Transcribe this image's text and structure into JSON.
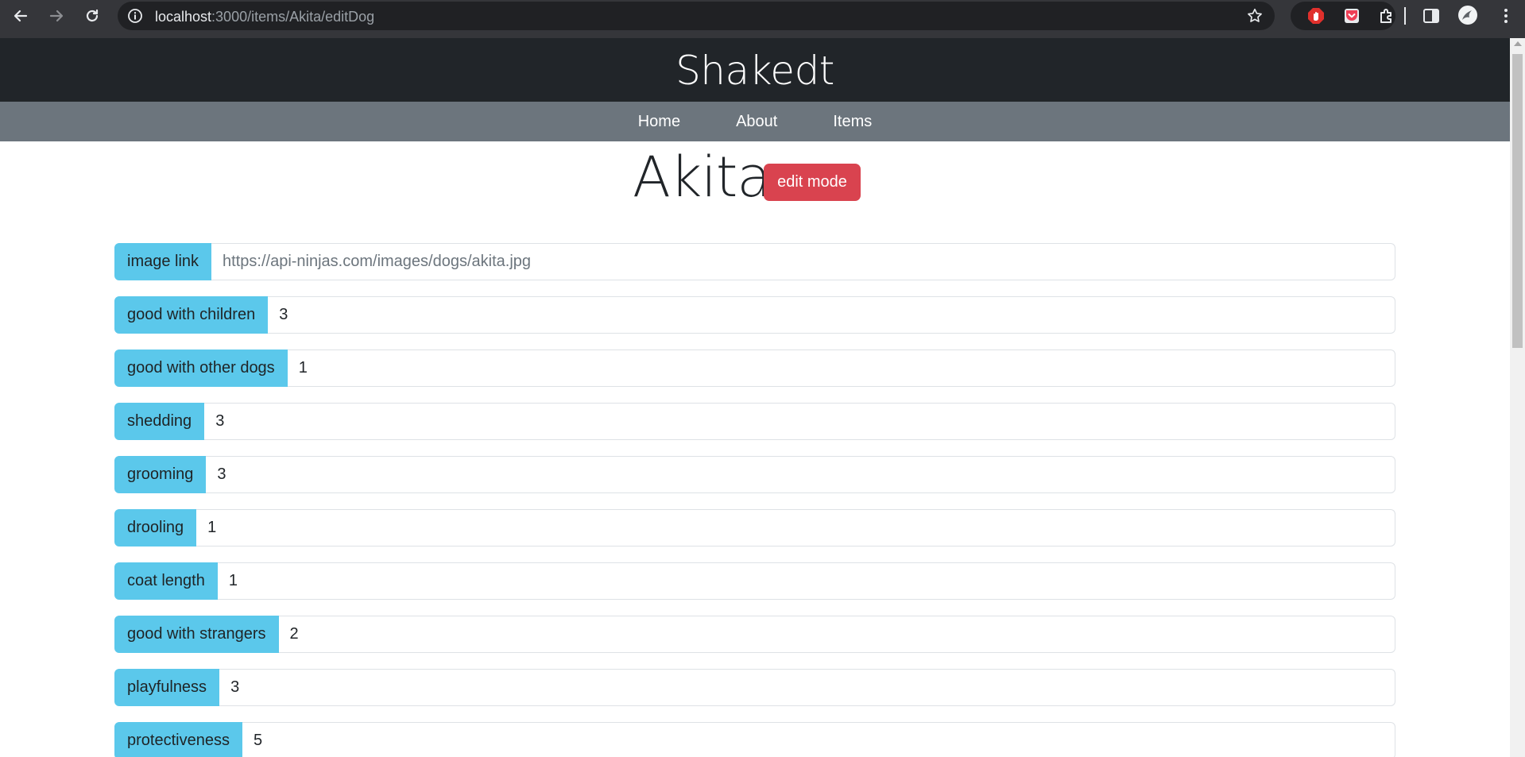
{
  "browser": {
    "url_host": "localhost",
    "url_path": ":3000/items/Akita/editDog",
    "icons": {
      "back": "arrow-left-icon",
      "forward": "arrow-right-icon",
      "reload": "reload-icon",
      "site_info": "info-icon",
      "bookmark": "star-icon",
      "extension_1": "adblock-icon",
      "extension_2": "pocket-icon",
      "extensions": "puzzle-icon",
      "side_panel": "side-panel-icon",
      "profile": "avatar",
      "menu": "kebab-menu-icon"
    }
  },
  "site": {
    "title": "Shakedt",
    "nav": [
      {
        "label": "Home"
      },
      {
        "label": "About"
      },
      {
        "label": "Items"
      }
    ]
  },
  "item": {
    "name": "Akita",
    "edit_button": "edit mode"
  },
  "fields": [
    {
      "label": "image link",
      "value": "",
      "placeholder": "https://api-ninjas.com/images/dogs/akita.jpg"
    },
    {
      "label": "good with children",
      "value": "3",
      "placeholder": ""
    },
    {
      "label": "good with other dogs",
      "value": "1",
      "placeholder": ""
    },
    {
      "label": "shedding",
      "value": "3",
      "placeholder": ""
    },
    {
      "label": "grooming",
      "value": "3",
      "placeholder": ""
    },
    {
      "label": "drooling",
      "value": "1",
      "placeholder": ""
    },
    {
      "label": "coat length",
      "value": "1",
      "placeholder": ""
    },
    {
      "label": "good with strangers",
      "value": "2",
      "placeholder": ""
    },
    {
      "label": "playfulness",
      "value": "3",
      "placeholder": ""
    },
    {
      "label": "protectiveness",
      "value": "5",
      "placeholder": ""
    }
  ],
  "colors": {
    "header_bg": "#212529",
    "nav_bg": "#6c757d",
    "label_bg": "#5bc8eb",
    "edit_button_bg": "#d9434f"
  }
}
